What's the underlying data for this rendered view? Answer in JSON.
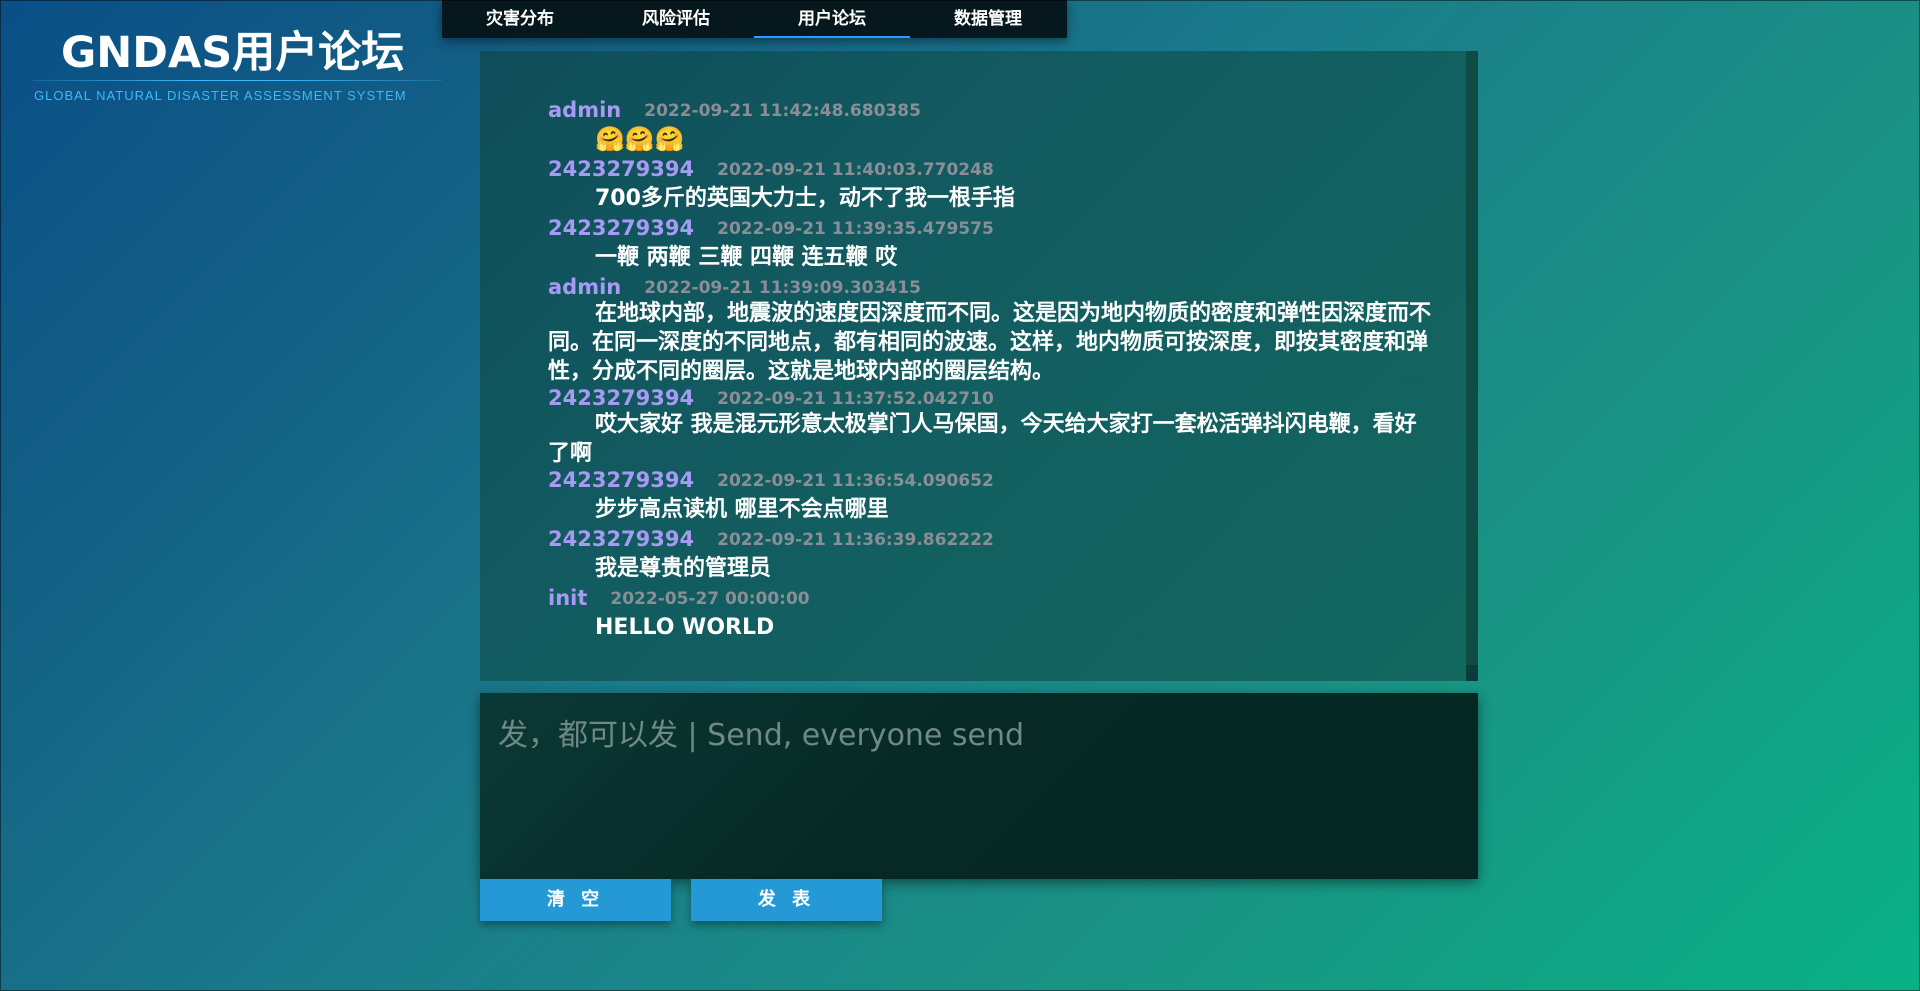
{
  "brand": {
    "title": "GNDAS用户论坛",
    "subtitle": "GLOBAL NATURAL DISASTER ASSESSMENT SYSTEM",
    "accent": "#3cb8ff"
  },
  "nav": {
    "tabs": [
      {
        "label": "灾害分布"
      },
      {
        "label": "风险评估"
      },
      {
        "label": "用户论坛"
      },
      {
        "label": "数据管理"
      }
    ]
  },
  "messages": [
    {
      "username": "admin",
      "timestamp": "2022-09-21 11:42:48.680385",
      "content": "🤗🤗🤗"
    },
    {
      "username": "2423279394",
      "timestamp": "2022-09-21 11:40:03.770248",
      "content": "700多斤的英国大力士，动不了我一根手指"
    },
    {
      "username": "2423279394",
      "timestamp": "2022-09-21 11:39:35.479575",
      "content": "一鞭 两鞭 三鞭 四鞭 连五鞭 哎"
    },
    {
      "username": "admin",
      "timestamp": "2022-09-21 11:39:09.303415",
      "content": "在地球内部，地震波的速度因深度而不同。这是因为地内物质的密度和弹性因深度而不同。在同一深度的不同地点，都有相同的波速。这样，地内物质可按深度，即按其密度和弹性，分成不同的圈层。这就是地球内部的圈层结构。"
    },
    {
      "username": "2423279394",
      "timestamp": "2022-09-21 11:37:52.042710",
      "content": "哎大家好 我是混元形意太极掌门人马保国，今天给大家打一套松活弹抖闪电鞭，看好了啊"
    },
    {
      "username": "2423279394",
      "timestamp": "2022-09-21 11:36:54.090652",
      "content": "步步高点读机 哪里不会点哪里"
    },
    {
      "username": "2423279394",
      "timestamp": "2022-09-21 11:36:39.862222",
      "content": "我是尊贵的管理员"
    },
    {
      "username": "init",
      "timestamp": "2022-05-27 00:00:00",
      "content": "HELLO WORLD"
    }
  ],
  "composer": {
    "placeholder": "发，都可以发 | Send, everyone send",
    "value": ""
  },
  "buttons": {
    "clear": "清 空",
    "submit": "发 表"
  },
  "icons": {
    "message-emoji": "hugging-face-icon"
  },
  "colors": {
    "nav_background": "#06181e",
    "active_tab_underline": "#2d9cff",
    "username": "#a79af4",
    "timestamp": "#8b8e96",
    "button": "#2499d6"
  }
}
